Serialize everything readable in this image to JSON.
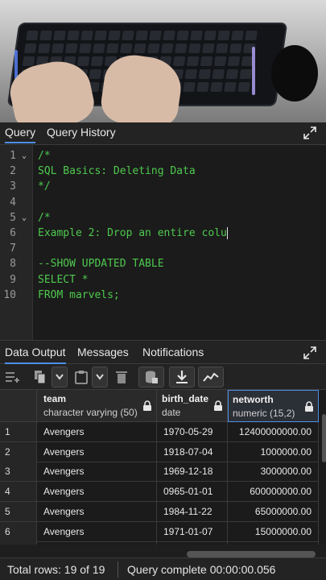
{
  "query_tabs": [
    {
      "label": "Query",
      "active": true
    },
    {
      "label": "Query History",
      "active": false
    }
  ],
  "editor": {
    "lines": [
      {
        "num": "1",
        "text": "/*",
        "fold": true
      },
      {
        "num": "2",
        "text": "SQL Basics: Deleting Data",
        "fold": false
      },
      {
        "num": "3",
        "text": "*/",
        "fold": false
      },
      {
        "num": "4",
        "text": "",
        "fold": false
      },
      {
        "num": "5",
        "text": "/*",
        "fold": true
      },
      {
        "num": "6",
        "text": "Example 2: Drop an entire colu",
        "fold": false,
        "caret": true
      },
      {
        "num": "7",
        "text": "",
        "fold": false
      },
      {
        "num": "8",
        "text": "--SHOW UPDATED TABLE",
        "fold": false
      },
      {
        "num": "9",
        "text": "SELECT *",
        "fold": false
      },
      {
        "num": "10",
        "text": "FROM marvels;",
        "fold": false
      }
    ],
    "code_color": "#4ec94e"
  },
  "output_tabs": [
    {
      "label": "Data Output",
      "active": true
    },
    {
      "label": "Messages",
      "active": false
    },
    {
      "label": "Notifications",
      "active": false
    }
  ],
  "toolbar": {
    "buttons": [
      "add-row-icon",
      "copy-icon",
      "chevron-down-icon",
      "paste-icon",
      "chevron-down-icon",
      "delete-icon",
      "save-data-icon",
      "download-icon",
      "graph-visualiser-icon"
    ]
  },
  "grid": {
    "columns": [
      {
        "name": "team",
        "type": "character varying (50)",
        "locked": true
      },
      {
        "name": "birth_date",
        "type": "date",
        "locked": true
      },
      {
        "name": "networth",
        "type": "numeric (15,2)",
        "locked": true
      }
    ],
    "rows": [
      {
        "n": "1",
        "team": "Avengers",
        "birth_date": "1970-05-29",
        "networth": "12400000000.00"
      },
      {
        "n": "2",
        "team": "Avengers",
        "birth_date": "1918-07-04",
        "networth": "1000000.00"
      },
      {
        "n": "3",
        "team": "Avengers",
        "birth_date": "1969-12-18",
        "networth": "3000000.00"
      },
      {
        "n": "4",
        "team": "Avengers",
        "birth_date": "0965-01-01",
        "networth": "600000000.00"
      },
      {
        "n": "5",
        "team": "Avengers",
        "birth_date": "1984-11-22",
        "networth": "65000000.00"
      },
      {
        "n": "6",
        "team": "Avengers",
        "birth_date": "1971-01-07",
        "networth": "15000000.00"
      }
    ]
  },
  "status": {
    "total_rows": "Total rows: 19 of 19",
    "query_complete": "Query complete 00:00:00.056"
  },
  "accent_color": "#4f8ee8"
}
